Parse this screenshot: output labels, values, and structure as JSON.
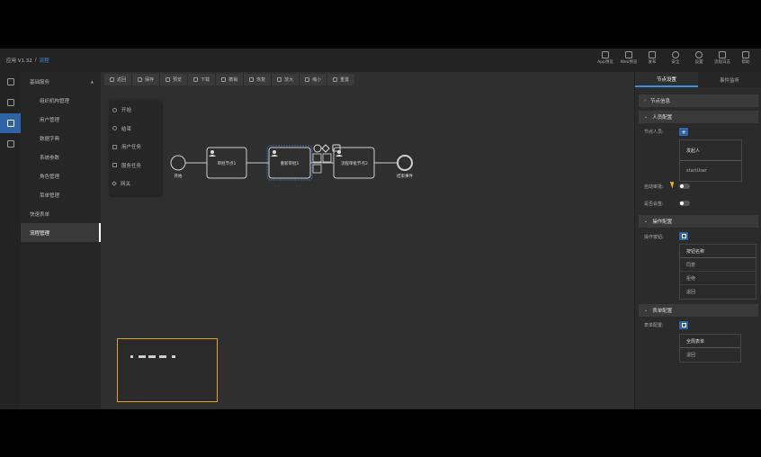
{
  "topbar": {
    "back_label": "应用 V1.32",
    "separator": "/",
    "crumb": "流程",
    "tools": [
      {
        "label": "App预览",
        "icon": "mobile-icon"
      },
      {
        "label": "Web预览",
        "icon": "monitor-icon"
      },
      {
        "label": "发布",
        "icon": "send-icon"
      },
      {
        "label": "安全",
        "icon": "shield-icon"
      },
      {
        "label": "设置",
        "icon": "gear-icon"
      },
      {
        "label": "流程日志",
        "icon": "log-icon"
      },
      {
        "label": "帮助",
        "icon": "help-icon"
      }
    ]
  },
  "menu": {
    "group": "基础服务",
    "items": [
      {
        "label": "组织机构管理",
        "sub": true
      },
      {
        "label": "用户管理",
        "sub": true
      },
      {
        "label": "数据字典",
        "sub": true
      },
      {
        "label": "系统参数",
        "sub": true
      },
      {
        "label": "角色管理",
        "sub": true
      },
      {
        "label": "菜单管理",
        "sub": true
      },
      {
        "label": "快速表单",
        "sub": false
      },
      {
        "label": "流程管理",
        "sub": false,
        "active": true
      }
    ]
  },
  "toolbar": [
    {
      "label": "返回",
      "icon": "back-icon"
    },
    {
      "label": "保存",
      "icon": "save-icon"
    },
    {
      "label": "预览",
      "icon": "preview-icon"
    },
    {
      "label": "下载",
      "icon": "download-icon"
    },
    {
      "label": "撤销",
      "icon": "undo-icon"
    },
    {
      "label": "恢复",
      "icon": "redo-icon"
    },
    {
      "label": "放大",
      "icon": "zoom-in-icon"
    },
    {
      "label": "缩小",
      "icon": "zoom-out-icon"
    },
    {
      "label": "重置",
      "icon": "reset-icon"
    }
  ],
  "palette": [
    {
      "label": "开始",
      "shape": "c"
    },
    {
      "label": "结束",
      "shape": "c"
    },
    {
      "label": "用户任务",
      "shape": "s"
    },
    {
      "label": "服务任务",
      "shape": "s"
    },
    {
      "label": "网关",
      "shape": "d"
    }
  ],
  "flow": {
    "start": "开始",
    "task1": "审批节点1",
    "task2": "重新审批1",
    "task3": "流程审批节点2",
    "end": "结束事件"
  },
  "rpanel": {
    "tabs": [
      "节点设置",
      "事件监听"
    ],
    "sec_node": "节点信息",
    "sec_people": "人员配置",
    "node_people_label": "节点人员:",
    "people_list": [
      "发起人",
      "startUser"
    ],
    "auto_approve_label": "自动审批:",
    "countersign_label": "是否会签:",
    "sec_ops": "操作配置",
    "ops_label": "操作按钮:",
    "ops_list": [
      "按钮名称",
      "同意",
      "拒绝",
      "退回"
    ],
    "sec_form": "表单配置",
    "form_label": "表单配置:",
    "form_list": [
      "全局表单",
      "退回"
    ]
  },
  "colors": {
    "accent": "#2f63a6",
    "link": "#3d8fe0",
    "minimap_border": "#e0a030"
  }
}
